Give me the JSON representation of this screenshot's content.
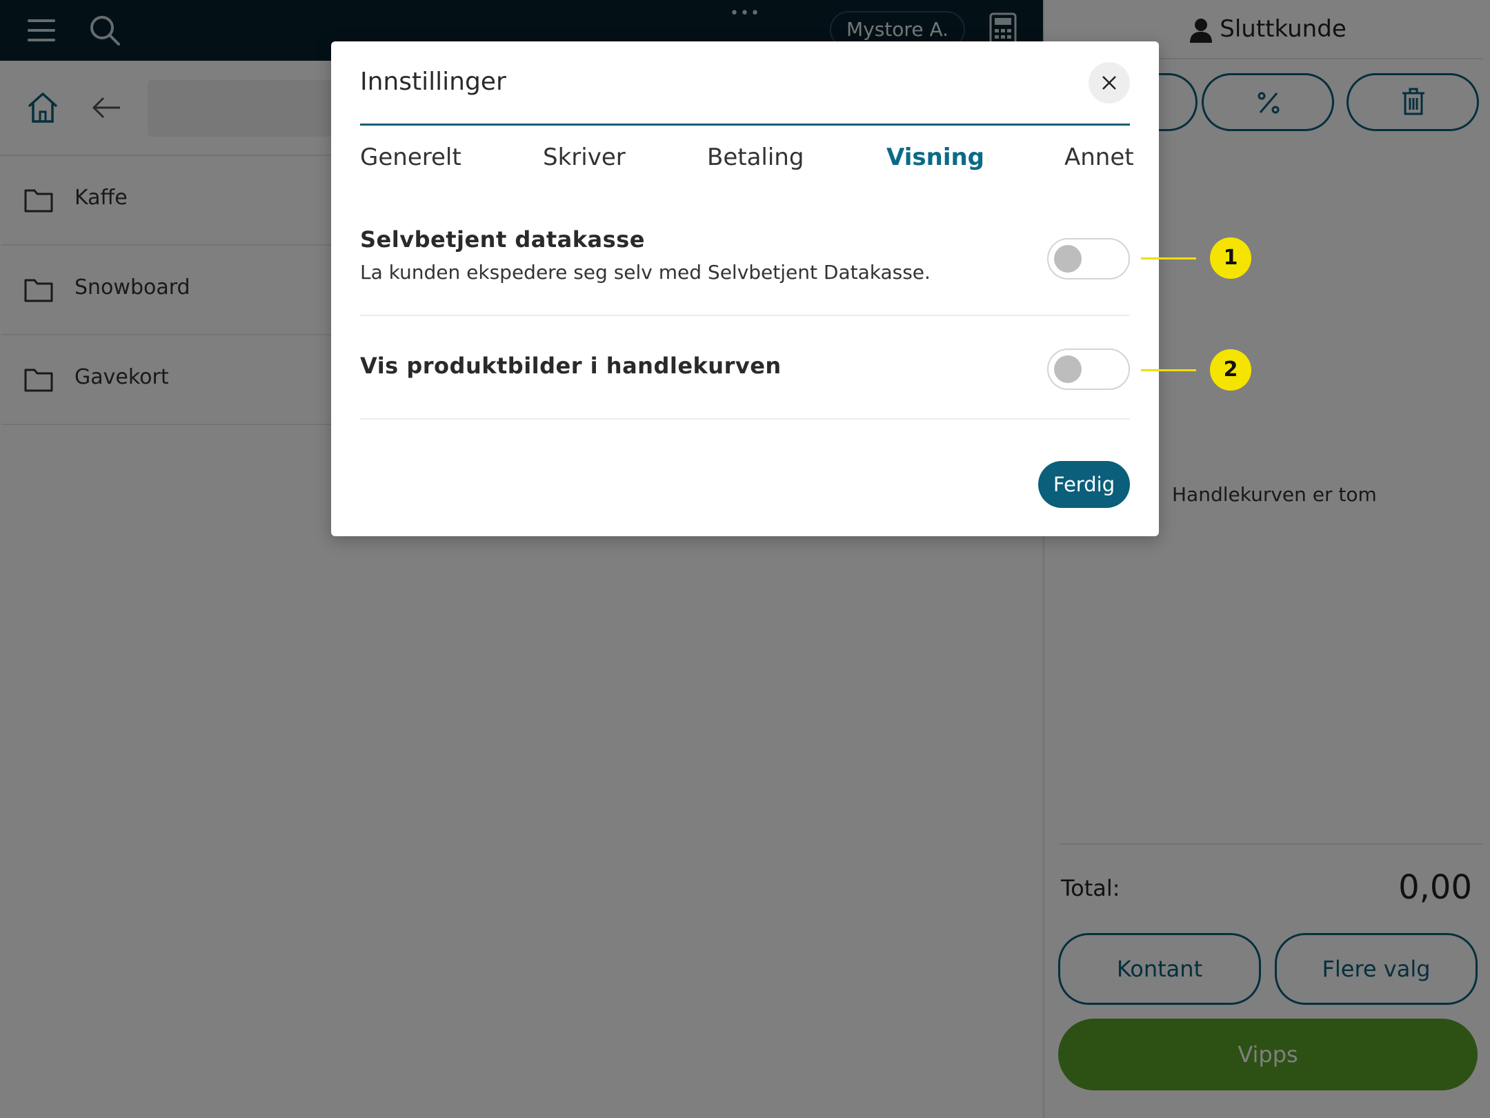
{
  "topbar": {
    "store_label": "Mystore A.",
    "dots": "•••"
  },
  "categories": [
    {
      "label": "Kaffe"
    },
    {
      "label": "Snowboard"
    },
    {
      "label": "Gavekort"
    }
  ],
  "cart": {
    "customer_label": "Sluttkunde",
    "empty_text": "Handlekurven er tom",
    "total_label": "Total:",
    "total_value": "0,00",
    "buttons": {
      "cash": "Kontant",
      "more": "Flere valg",
      "vipps": "Vipps"
    }
  },
  "dialog": {
    "title": "Innstillinger",
    "tabs": [
      {
        "label": "Generelt",
        "active": false
      },
      {
        "label": "Skriver",
        "active": false
      },
      {
        "label": "Betaling",
        "active": false
      },
      {
        "label": "Visning",
        "active": true
      },
      {
        "label": "Annet",
        "active": false
      }
    ],
    "settings": [
      {
        "title": "Selvbetjent datakasse",
        "description": "La kunden ekspedere seg selv med Selvbetjent Datakasse.",
        "enabled": false
      },
      {
        "title": "Vis produktbilder i handlekurven",
        "enabled": false
      }
    ],
    "done_label": "Ferdig"
  },
  "callouts": [
    "1",
    "2"
  ],
  "colors": {
    "primary": "#0b5f7a",
    "topbar": "#06232e",
    "vipps": "#5aa228",
    "callout": "#f4e400"
  }
}
